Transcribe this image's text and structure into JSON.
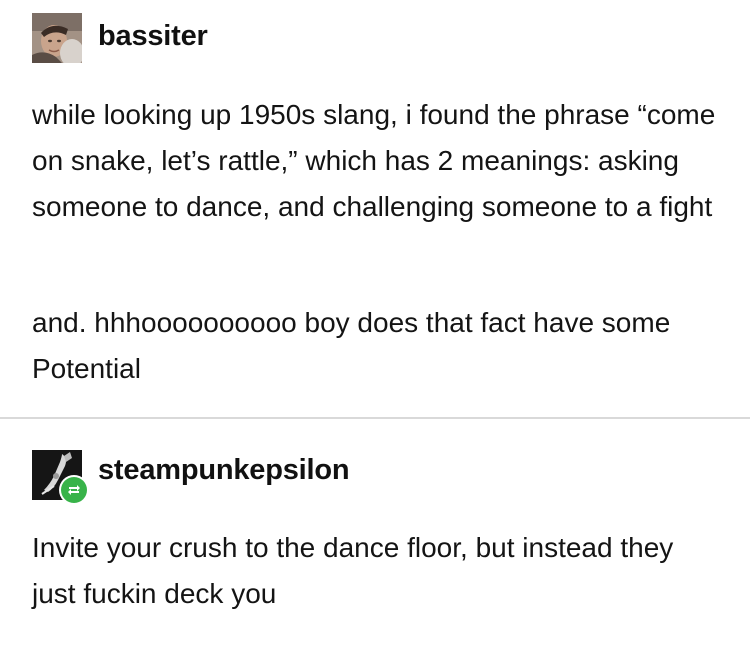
{
  "post1": {
    "username": "bassiter",
    "paragraphs": [
      "while looking up 1950s slang, i found the phrase “come on snake, let’s rattle,” which has 2 meanings: asking someone to dance, and challenging someone to a fight",
      "and. hhhoooooooooo boy does that fact have some Potential"
    ],
    "avatar_icon": "profile-photo"
  },
  "post2": {
    "username": "steampunkepsilon",
    "paragraphs": [
      "Invite your crush to the dance floor, but instead they just fuckin deck you"
    ],
    "avatar_icon": "profile-photo",
    "badge_icon": "reblog-icon",
    "badge_color": "#38b349"
  }
}
